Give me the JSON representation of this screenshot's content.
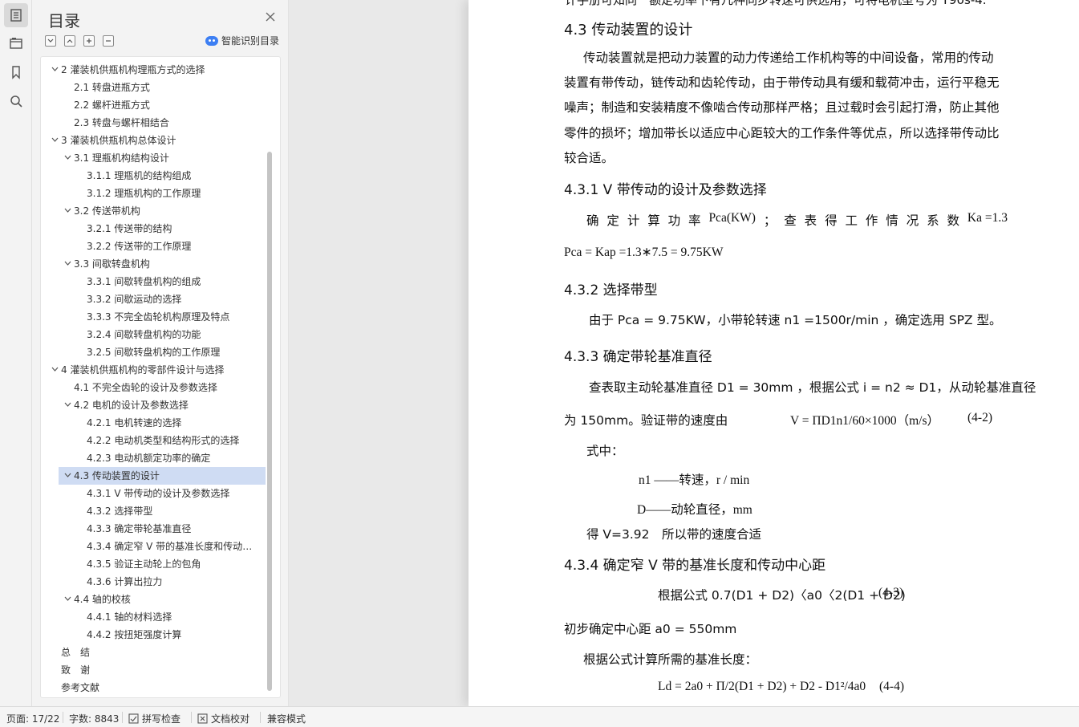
{
  "toc": {
    "title": "目录",
    "smart_label": "智能识别目录",
    "items": [
      {
        "label": "2 灌装机供瓶机构理瓶方式的选择",
        "level": 1,
        "expanded": true
      },
      {
        "label": "2.1 转盘进瓶方式",
        "level": 2
      },
      {
        "label": "2.2 螺杆进瓶方式",
        "level": 2
      },
      {
        "label": "2.3 转盘与螺杆相结合",
        "level": 2
      },
      {
        "label": "3 灌装机供瓶机构总体设计",
        "level": 1,
        "expanded": true
      },
      {
        "label": "3.1 理瓶机构结构设计",
        "level": 2,
        "expanded": true
      },
      {
        "label": "3.1.1 理瓶机的结构组成",
        "level": 3
      },
      {
        "label": "3.1.2 理瓶机构的工作原理",
        "level": 3
      },
      {
        "label": "3.2 传送带机构",
        "level": 2,
        "expanded": true
      },
      {
        "label": "3.2.1 传送带的结构",
        "level": 3
      },
      {
        "label": "3.2.2 传送带的工作原理",
        "level": 3
      },
      {
        "label": "3.3 间歇转盘机构",
        "level": 2,
        "expanded": true
      },
      {
        "label": "3.3.1 间歇转盘机构的组成",
        "level": 3
      },
      {
        "label": "3.3.2 间歇运动的选择",
        "level": 3
      },
      {
        "label": "3.3.3 不完全齿轮机构原理及特点",
        "level": 3
      },
      {
        "label": "3.2.4 间歇转盘机构的功能",
        "level": 3
      },
      {
        "label": "3.2.5 间歇转盘机构的工作原理",
        "level": 3
      },
      {
        "label": "4 灌装机供瓶机构的零部件设计与选择",
        "level": 1,
        "expanded": true
      },
      {
        "label": "4.1 不完全齿轮的设计及参数选择",
        "level": 2
      },
      {
        "label": "4.2 电机的设计及参数选择",
        "level": 2,
        "expanded": true
      },
      {
        "label": "4.2.1 电机转速的选择",
        "level": 3
      },
      {
        "label": "4.2.2 电动机类型和结构形式的选择",
        "level": 3
      },
      {
        "label": "4.2.3 电动机额定功率的确定",
        "level": 3
      },
      {
        "label": "4.3 传动装置的设计",
        "level": 2,
        "expanded": true,
        "selected": true
      },
      {
        "label": "4.3.1 V 带传动的设计及参数选择",
        "level": 3
      },
      {
        "label": "4.3.2 选择带型",
        "level": 3
      },
      {
        "label": "4.3.3 确定带轮基准直径",
        "level": 3
      },
      {
        "label": "4.3.4 确定窄 V 带的基准长度和传动中心距",
        "level": 3
      },
      {
        "label": "4.3.5 验证主动轮上的包角",
        "level": 3
      },
      {
        "label": "4.3.6 计算出拉力",
        "level": 3
      },
      {
        "label": "4.4 轴的校核",
        "level": 2,
        "expanded": true
      },
      {
        "label": "4.4.1 轴的材料选择",
        "level": 3
      },
      {
        "label": "4.4.2 按扭矩强度计算",
        "level": 3
      },
      {
        "label": "总　结",
        "level": 1
      },
      {
        "label": "致　谢",
        "level": 1
      },
      {
        "label": "参考文献",
        "level": 1
      }
    ]
  },
  "doc": {
    "cut_top": "计手册可知同一额定功率下有几种同步转速可供选用，可将电机型号为 Y90s-4.",
    "h_4_3": "4.3 传动装置的设计",
    "para1": [
      "传动装置就是把动力装置的动力传递给工作机构等的中间设备，常用的传动",
      "装置有带传动，链传动和齿轮传动，由于带传动具有缓和载荷冲击，运行平稳无",
      "噪声；制造和安装精度不像啮合传动那样严格；且过载时会引起打滑，防止其他",
      "零件的损坏；增加带长以适应中心距较大的工作条件等优点，所以选择带传动比",
      "较合适。"
    ],
    "h_4_3_1": "4.3.1 V 带传动的设计及参数选择",
    "calc_line": [
      "确",
      "定",
      "计",
      "算",
      "功",
      "率",
      "Pca(KW)",
      "；",
      "查",
      "表",
      "得",
      "工",
      "作",
      "情",
      "况",
      "系",
      "数",
      "Ka =1.3"
    ],
    "pca_eq": "Pca = Kap =1.3∗7.5 = 9.75KW",
    "h_4_3_2": "4.3.2 选择带型",
    "select_line": "由于 Pca = 9.75KW，小带轮转速 n1 =1500r/min ，确定选用 SPZ 型。",
    "h_4_3_3": "4.3.3 确定带轮基准直径",
    "d1_line": "查表取主动轮基准直径 D1 = 30mm ，根据公式 i = n2 ≈ D1，从动轮基准直径",
    "d2_line_a": "为 150mm。验证带的速度由",
    "d2_line_b": "V = ΠD1n1/60×1000（m/s）",
    "d2_line_c": "(4-2)",
    "where": "式中：",
    "n1_def": "n1 ——转速，r / min",
    "d_def": "D——动轮直径，mm",
    "v_result": "得 V=3.92　所以带的速度合适",
    "h_4_3_4": "4.3.4 确定窄 V 带的基准长度和传动中心距",
    "formula_43": "根据公式 0.7(D1 + D2)〈a0〈2(D1 + D2)",
    "formula_43_no": "(4-3)",
    "a0_line": "初步确定中心距 a0 = 550mm",
    "len_line": "根据公式计算所需的基准长度：",
    "formula_44": "Ld = 2a0 + Π/2(D1 + D2) + D2 - D1²/4a0",
    "formula_44_no": "(4-4)"
  },
  "status": {
    "page": "页面: 17/22",
    "words": "字数: 8843",
    "spell": "拼写检查",
    "proof": "文档校对",
    "compat": "兼容模式"
  },
  "colors": {
    "selected_bg": "#cfdcf3",
    "accent": "#3d7ff3"
  }
}
